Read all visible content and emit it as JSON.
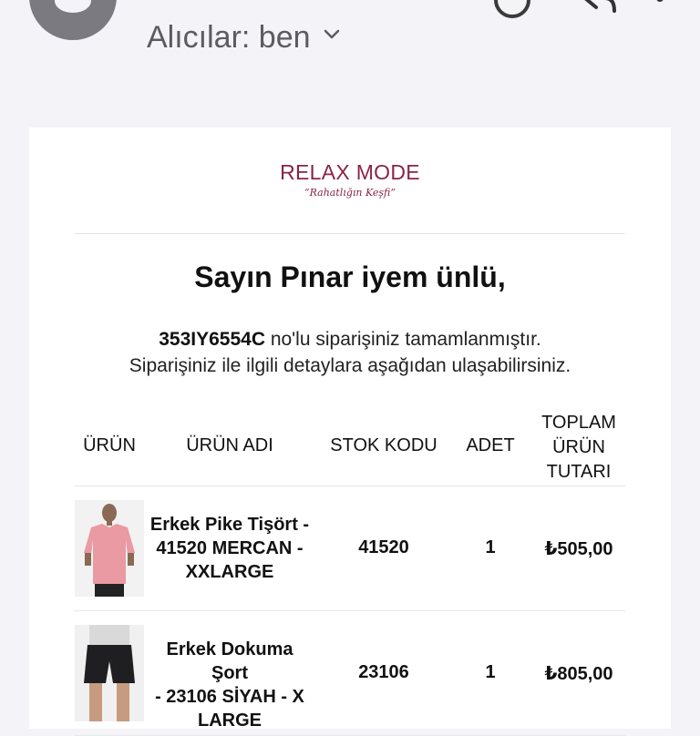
{
  "header": {
    "recipients_label": "Alıcılar: ben"
  },
  "email": {
    "brand": {
      "name": "RELAX MODE",
      "tagline": "“Rahatlığın Keşfi”",
      "color": "#8a2447"
    },
    "greeting": "Sayın Pınar iyem ünlü,",
    "order_number": "353IY6554C",
    "message_line1_rest": " no'lu siparişiniz tamamlanmıştır.",
    "message_line2": "Siparişiniz ile ilgili detaylara aşağıdan ulaşabilirsiniz.",
    "table": {
      "headers": {
        "image": "ÜRÜN",
        "name": "ÜRÜN ADI",
        "sku": "STOK KODU",
        "qty": "ADET",
        "total_line1": "TOPLAM",
        "total_line2": "ÜRÜN",
        "total_line3": "TUTARI"
      },
      "rows": [
        {
          "name_line1": "Erkek Pike Tişört -",
          "name_line2": "41520 MERCAN -",
          "name_line3": "XXLARGE",
          "sku": "41520",
          "qty": "1",
          "total": "₺505,00",
          "image_icon": "pink-polo-shirt-photo"
        },
        {
          "name_line1": "Erkek Dokuma Şort",
          "name_line2": "- 23106 SİYAH - X",
          "name_line3": "LARGE",
          "sku": "23106",
          "qty": "1",
          "total": "₺805,00",
          "image_icon": "black-shorts-photo"
        }
      ]
    }
  }
}
